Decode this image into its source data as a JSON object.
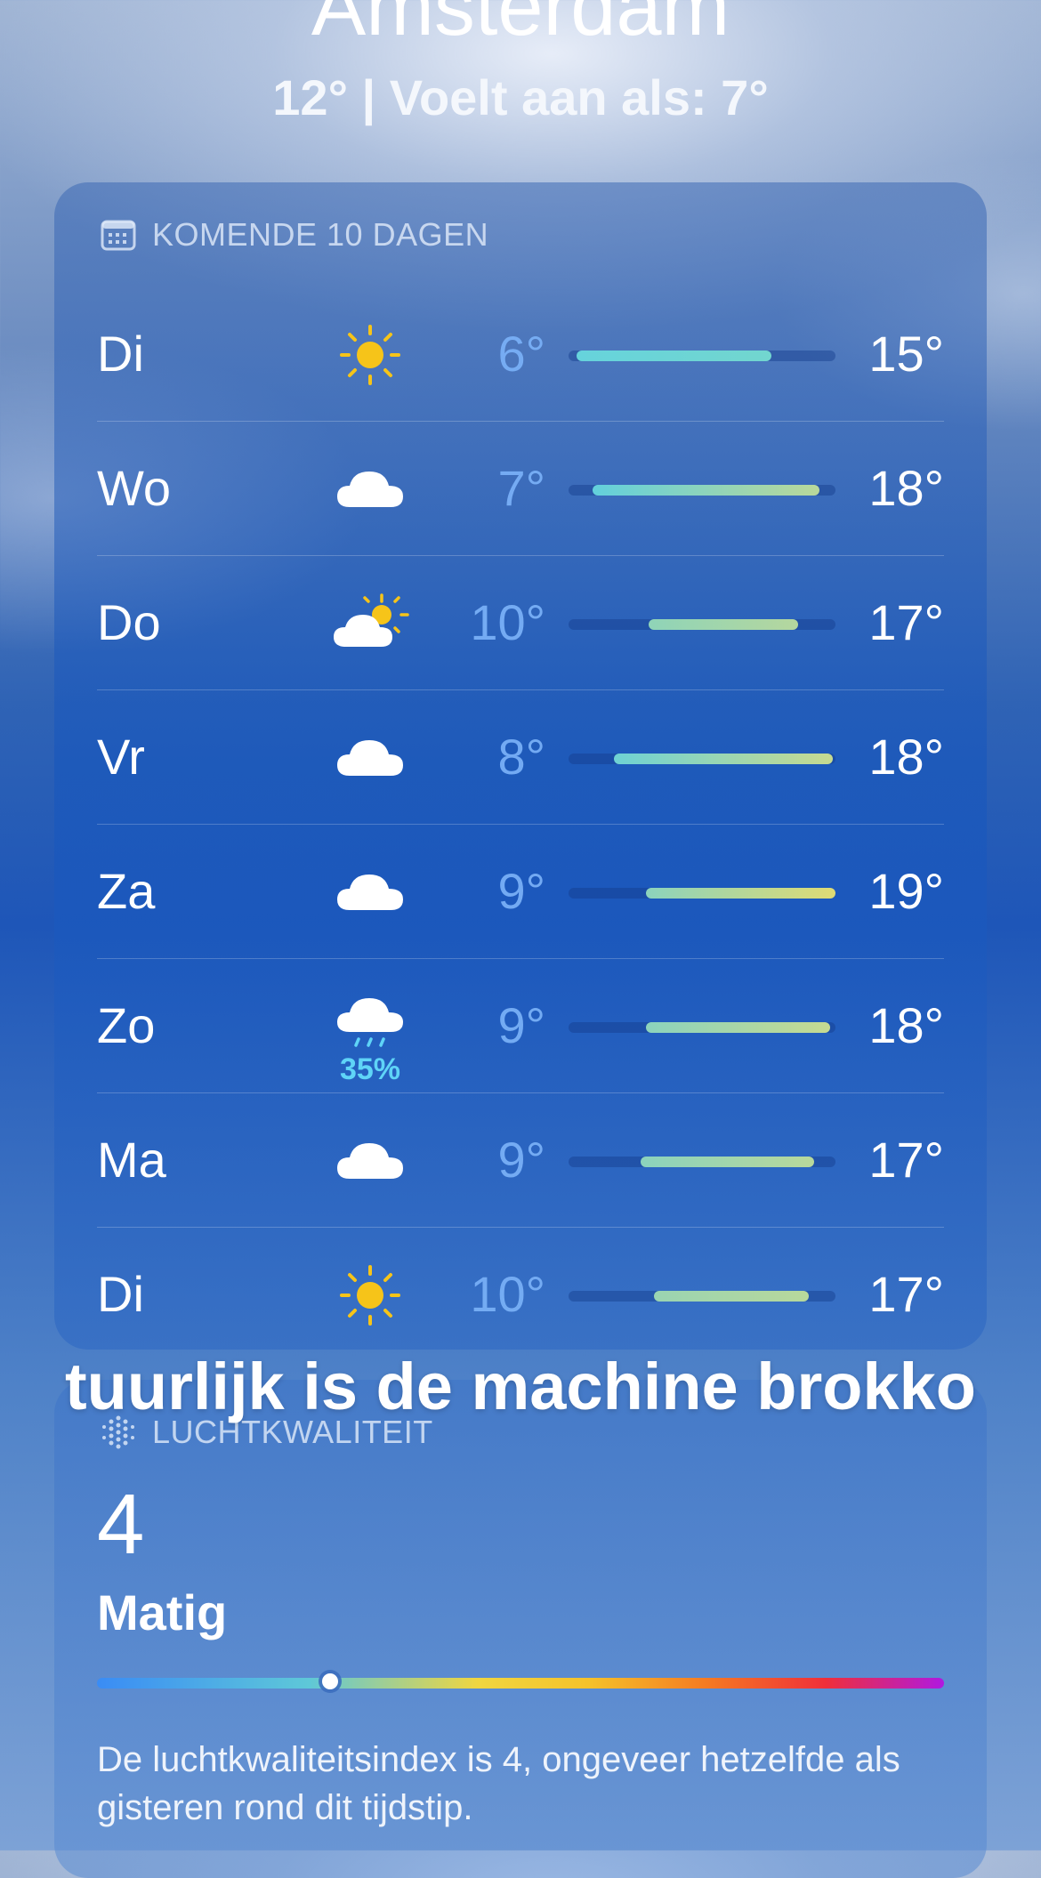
{
  "header": {
    "city": "Amsterdam",
    "current": "12°  |  Voelt aan als: 7°"
  },
  "forecast": {
    "title": "KOMENDE 10 DAGEN",
    "icon": "calendar-icon",
    "days": [
      {
        "day": "Di",
        "icon": "sun-icon",
        "low": "6°",
        "high": "15°",
        "range": [
          0.03,
          0.76
        ],
        "grad": "#66d3dc,#72d6cf"
      },
      {
        "day": "Wo",
        "icon": "cloud-icon",
        "low": "7°",
        "high": "18°",
        "range": [
          0.09,
          0.94
        ],
        "grad": "#62d0dc,#b9d89a"
      },
      {
        "day": "Do",
        "icon": "partly-cloudy-icon",
        "low": "10°",
        "high": "17°",
        "range": [
          0.3,
          0.86
        ],
        "grad": "#8fd4b8,#b5d79e"
      },
      {
        "day": "Vr",
        "icon": "cloud-icon",
        "low": "8°",
        "high": "18°",
        "range": [
          0.17,
          0.99
        ],
        "grad": "#6ed2d4,#c7da90"
      },
      {
        "day": "Za",
        "icon": "cloud-icon",
        "low": "9°",
        "high": "19°",
        "range": [
          0.29,
          1.0
        ],
        "grad": "#8bd3bd,#dfdb74"
      },
      {
        "day": "Zo",
        "icon": "rain-cloud-icon",
        "precip": "35%",
        "low": "9°",
        "high": "18°",
        "range": [
          0.29,
          0.98
        ],
        "grad": "#8bd3bd,#c6da91"
      },
      {
        "day": "Ma",
        "icon": "cloud-icon",
        "low": "9°",
        "high": "17°",
        "range": [
          0.27,
          0.92
        ],
        "grad": "#8bd3bd,#b8d89b"
      },
      {
        "day": "Di",
        "icon": "sun-icon",
        "low": "10°",
        "high": "17°",
        "range": [
          0.32,
          0.9
        ],
        "grad": "#9ad4b2,#b8d89b"
      }
    ]
  },
  "air_quality": {
    "title": "LUCHTKWALITEIT",
    "icon": "air-quality-icon",
    "value": "4",
    "category": "Matig",
    "marker_fraction": 0.275,
    "description": "De luchtkwaliteitsindex is 4, ongeveer hetzelfde als gisteren rond dit tijdstip."
  },
  "overlay_caption": "tuurlijk is de machine brokko"
}
